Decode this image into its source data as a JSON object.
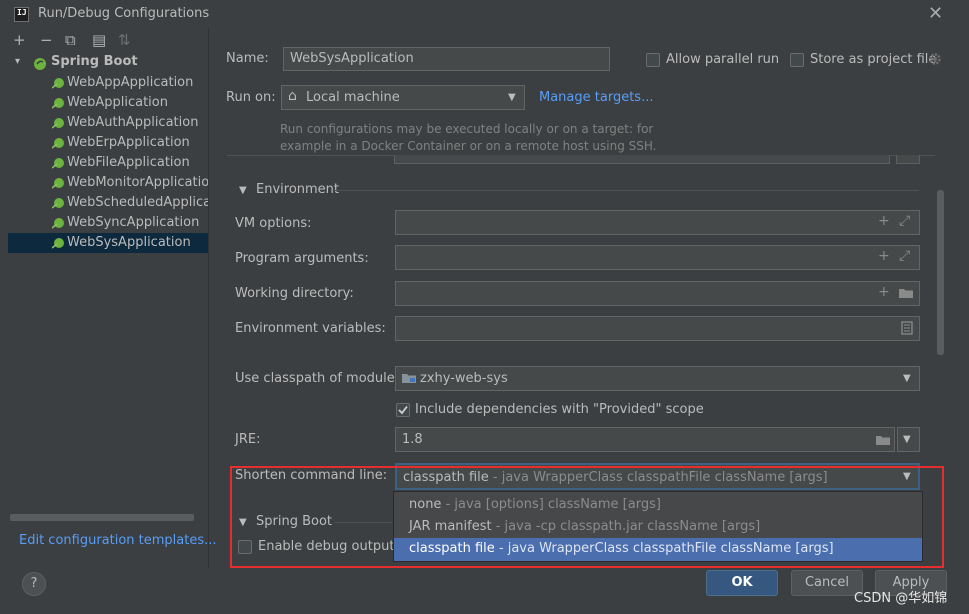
{
  "window": {
    "title": "Run/Debug Configurations",
    "close_glyph": "✕",
    "app_icon_text": "IJ"
  },
  "toolbar": {
    "add_glyph": "+",
    "remove_glyph": "−",
    "copy_glyph": "⧉",
    "folder_glyph": "▤",
    "sort_glyph": "⇅"
  },
  "tree": {
    "root": "Spring Boot",
    "items": [
      {
        "label": "WebAppApplication"
      },
      {
        "label": "WebApplication"
      },
      {
        "label": "WebAuthApplication"
      },
      {
        "label": "WebErpApplication"
      },
      {
        "label": "WebFileApplication"
      },
      {
        "label": "WebMonitorApplication"
      },
      {
        "label": "WebScheduledApplicatio"
      },
      {
        "label": "WebSyncApplication"
      },
      {
        "label": "WebSysApplication",
        "selected": true
      }
    ],
    "edit_templates": "Edit configuration templates..."
  },
  "form": {
    "name_label": "Name:",
    "name_value": "WebSysApplication",
    "allow_parallel": "Allow parallel run",
    "store_project_file": "Store as project file",
    "run_on_label": "Run on:",
    "run_on_value": "Local machine",
    "manage_targets": "Manage targets...",
    "run_on_hint_line1": "Run configurations may be executed locally or on a target: for",
    "run_on_hint_line2": "example in a Docker Container or on a remote host using SSH.",
    "environment_section": "Environment",
    "vm_options_label": "VM options:",
    "program_args_label": "Program arguments:",
    "working_dir_label": "Working directory:",
    "env_vars_label": "Environment variables:",
    "classpath_label": "Use classpath of module:",
    "classpath_value": "zxhy-web-sys",
    "include_deps": "Include dependencies with \"Provided\" scope",
    "jre_label": "JRE:",
    "jre_value": "1.8",
    "shorten_label": "Shorten command line:",
    "shorten_value_main": "classpath file",
    "shorten_value_sub": " - java WrapperClass classpathFile className [args]",
    "spring_boot_section": "Spring Boot",
    "enable_debug": "Enable debug output"
  },
  "dropdown_options": [
    {
      "main": "none",
      "sub": " - java [options] className [args]"
    },
    {
      "main": "JAR manifest",
      "sub": " - java -cp classpath.jar className [args]"
    },
    {
      "main": "classpath file",
      "sub": " - java WrapperClass classpathFile className [args]",
      "selected": true
    }
  ],
  "buttons": {
    "ok": "OK",
    "cancel": "Cancel",
    "apply": "Apply",
    "help": "?"
  },
  "watermark": "CSDN @华如锦",
  "icons": {
    "expand_add": "+",
    "expand_arrows": "⤢",
    "folder": "📁",
    "doc": "▤",
    "home": "⌂",
    "tree_arrow": "▾",
    "section_arrow": "▼",
    "dropdown": "▼"
  },
  "colors": {
    "background": "#3c3f41",
    "accent": "#4b6eaf",
    "link": "#589df6",
    "highlight_border": "#e62e2e"
  }
}
